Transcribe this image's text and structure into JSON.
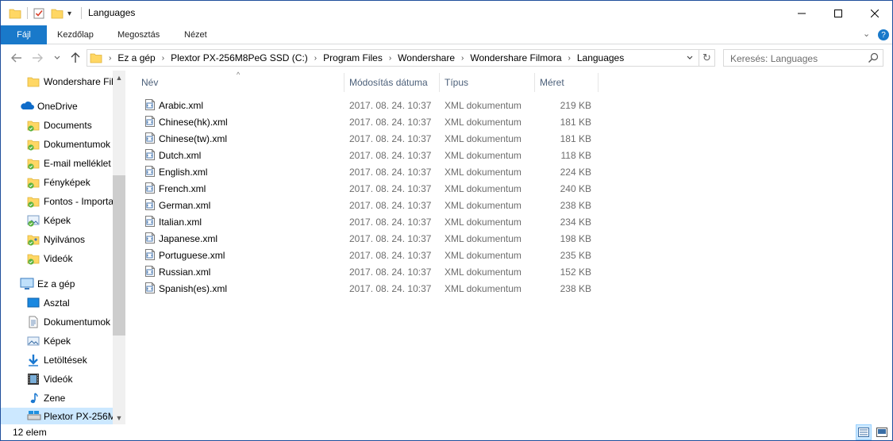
{
  "window": {
    "title": "Languages",
    "controls": {
      "minimize": "—",
      "maximize": "☐",
      "close": "✕"
    }
  },
  "ribbon": {
    "tabs": [
      {
        "label": "Fájl",
        "active": true
      },
      {
        "label": "Kezdőlap"
      },
      {
        "label": "Megosztás"
      },
      {
        "label": "Nézet"
      }
    ],
    "expand_glyph": "⌄",
    "help_glyph": "?"
  },
  "navigation": {
    "back": "←",
    "forward": "→",
    "recent": "⌄",
    "up": "↑",
    "breadcrumb": [
      "Ez a gép",
      "Plextor PX-256M8PeG SSD (C:)",
      "Program Files",
      "Wondershare",
      "Wondershare Filmora",
      "Languages"
    ],
    "crumb_separator": "›",
    "refresh": "↻",
    "dropdown": "⌄"
  },
  "search": {
    "placeholder": "Keresés: Languages"
  },
  "sidebar": {
    "items": [
      {
        "label": "Wondershare Fil",
        "icon": "folder-icon"
      },
      {
        "label": "OneDrive",
        "icon": "onedrive-icon"
      },
      {
        "label": "Documents",
        "icon": "folder-synced-icon"
      },
      {
        "label": "Dokumentumok",
        "icon": "folder-synced-icon"
      },
      {
        "label": "E-mail melléklet",
        "icon": "folder-synced-icon"
      },
      {
        "label": "Fényképek",
        "icon": "folder-synced-icon"
      },
      {
        "label": "Fontos - Importa",
        "icon": "folder-synced-icon"
      },
      {
        "label": "Képek",
        "icon": "pictures-synced-icon"
      },
      {
        "label": "Nyilvános",
        "icon": "folder-shared-synced-icon"
      },
      {
        "label": "Videók",
        "icon": "folder-synced-icon"
      },
      {
        "label": "Ez a gép",
        "icon": "this-pc-icon"
      },
      {
        "label": "Asztal",
        "icon": "desktop-icon"
      },
      {
        "label": "Dokumentumok",
        "icon": "documents-icon"
      },
      {
        "label": "Képek",
        "icon": "pictures-icon"
      },
      {
        "label": "Letöltések",
        "icon": "downloads-icon"
      },
      {
        "label": "Videók",
        "icon": "videos-icon"
      },
      {
        "label": "Zene",
        "icon": "music-icon"
      },
      {
        "label": "Plextor PX-256M",
        "icon": "drive-icon",
        "selected": true
      }
    ],
    "scroll_up": "▲",
    "scroll_down": "▼"
  },
  "filelist": {
    "columns": {
      "name": "Név",
      "modified": "Módosítás dátuma",
      "type": "Típus",
      "size": "Méret"
    },
    "sort_indicator": "^",
    "files": [
      {
        "name": "Arabic.xml",
        "modified": "2017. 08. 24. 10:37",
        "type": "XML dokumentum",
        "size": "219 KB"
      },
      {
        "name": "Chinese(hk).xml",
        "modified": "2017. 08. 24. 10:37",
        "type": "XML dokumentum",
        "size": "181 KB"
      },
      {
        "name": "Chinese(tw).xml",
        "modified": "2017. 08. 24. 10:37",
        "type": "XML dokumentum",
        "size": "181 KB"
      },
      {
        "name": "Dutch.xml",
        "modified": "2017. 08. 24. 10:37",
        "type": "XML dokumentum",
        "size": "118 KB"
      },
      {
        "name": "English.xml",
        "modified": "2017. 08. 24. 10:37",
        "type": "XML dokumentum",
        "size": "224 KB"
      },
      {
        "name": "French.xml",
        "modified": "2017. 08. 24. 10:37",
        "type": "XML dokumentum",
        "size": "240 KB"
      },
      {
        "name": "German.xml",
        "modified": "2017. 08. 24. 10:37",
        "type": "XML dokumentum",
        "size": "238 KB"
      },
      {
        "name": "Italian.xml",
        "modified": "2017. 08. 24. 10:37",
        "type": "XML dokumentum",
        "size": "234 KB"
      },
      {
        "name": "Japanese.xml",
        "modified": "2017. 08. 24. 10:37",
        "type": "XML dokumentum",
        "size": "198 KB"
      },
      {
        "name": "Portuguese.xml",
        "modified": "2017. 08. 24. 10:37",
        "type": "XML dokumentum",
        "size": "235 KB"
      },
      {
        "name": "Russian.xml",
        "modified": "2017. 08. 24. 10:37",
        "type": "XML dokumentum",
        "size": "152 KB"
      },
      {
        "name": "Spanish(es).xml",
        "modified": "2017. 08. 24. 10:37",
        "type": "XML dokumentum",
        "size": "238 KB"
      }
    ]
  },
  "status": {
    "item_count": "12 elem"
  },
  "colors": {
    "accent": "#1979ca",
    "selection": "#cce8ff",
    "folder": "#ffd764",
    "header_text": "#4c607a",
    "muted_text": "#6d6d6d"
  }
}
